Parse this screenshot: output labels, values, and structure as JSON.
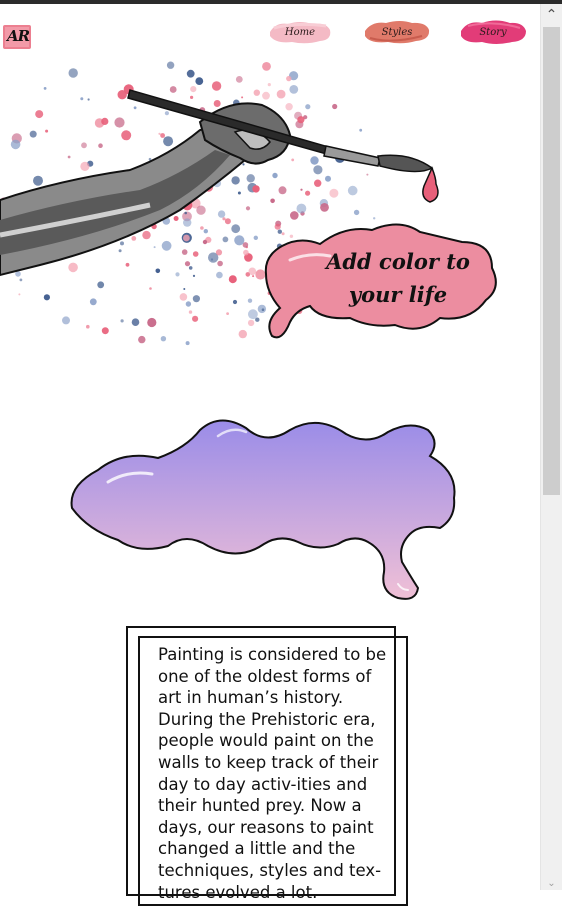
{
  "logo": {
    "text": "AR"
  },
  "nav": {
    "items": [
      {
        "label": "Home",
        "color": "#f3b3bf"
      },
      {
        "label": "Styles",
        "color": "#e07a6a"
      },
      {
        "label": "Story",
        "color": "#e23c78"
      }
    ]
  },
  "hero": {
    "tagline_line1": "Add color to",
    "tagline_line2": "your life"
  },
  "story": {
    "paragraph": "Painting is considered to be one of the oldest forms of art in human’s history. During the Prehistoric era, people would paint on the walls to keep track of their day to day activ-ities and their hunted prey. Now a days, our reasons to paint changed a little and the techniques, styles and tex-tures evolved a lot."
  },
  "colors": {
    "pink_blob": "#ec8da0",
    "purple_blob_top": "#9a8ce8",
    "purple_blob_bottom": "#f0c0d6",
    "splatter_blue": "#3d5a8c",
    "splatter_pink": "#e8607a"
  },
  "icons": {
    "scroll_up": "chevron-up-icon",
    "scroll_down": "chevron-down-icon"
  }
}
